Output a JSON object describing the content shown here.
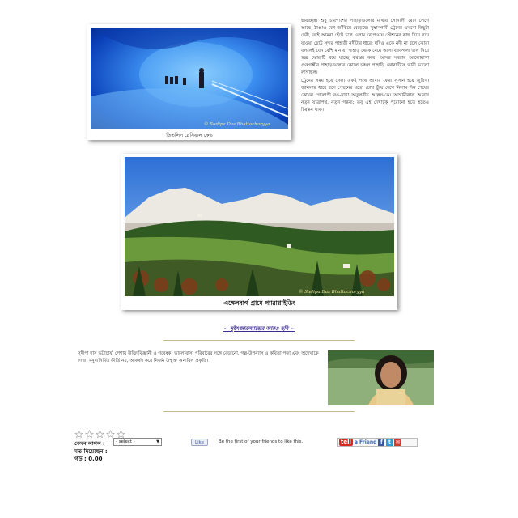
{
  "photo1": {
    "caption": "তিতলিস গ্লেসিয়াল কেভ",
    "watermark": "© Sudipa Das Bhattacharyya",
    "icon": "ice-cave-photo"
  },
  "article_text": {
    "p1": "ছায়াচ্ছন্ন। শুধু চারপাশের পাহাড়গুলোর মাথায় সোনালী রোদ লেগে আছে। ঠাণ্ডাও বেশ জাঁকিয়ে বেড়েছে। সুস্থানগামী ট্রেনের এখনো কিছুটা দেরী, তাই আমরা হেঁটে চলে এলাম রোপওয়ে স্টেশনের কাছ দিয়ে বয়ে যাওয়া ছোট্ট সুন্দর পাহাড়ী নদীটার ধারে; যদিও একে নদী না বলে ঝোরা বললেই যেন বেশি মানায়। পাহাড় থেকে নেমে আসা বরফগলা জল নিয়ে স্বচ্ছ ঝোরাটি বয়ে যাচ্ছে ঝরঝর করে। আসন্ন সন্ধ্যার আলোমাখা গুরুগম্ভীর পাহাড়গুলোর কোলে চঞ্চল পাহাড়ি ঝোরাটিকে ভারী ভালো লাগছিল।",
    "p2": "ট্রেনের সময় হয়ে গেল। একই পথে আবার ফেরা লুসার্ন হয়ে জুরিখ। জানলার ধারে বসে পেছনের মতো চোখ ছুঁয়ে দেখে নিলাম দিন শেষের কোমল গোলাপী রঙ-মাখা অতুলনীয় আল্পস-কে। আগামীকাল আবার নতুন যাত্রাপথ, নতুন গন্তব্য; তবু এই দেখাটুকু পুরোনো হতে হতেও চিরন্তন থাক।"
  },
  "photo2": {
    "caption": "এঙ্গেলবার্গ গ্রামে প্যারাগ্লাইডিং",
    "watermark": "© Sudipa Das Bhattacharyya",
    "icon": "alps-village-photo"
  },
  "more_link": "~ সুইৎজারল্যান্ডের আরও ছবি ~",
  "author": {
    "bio": "সুদীপা দাস ভট্টাচার্য্য পেশায় উদ্ভিদবিজ্ঞানী ও গবেষক। ভালোবাসা পরিবারের সঙ্গে বেড়ানো, গল্প-উপন্যাস ও কবিতা পড়া এবং অদেখাকে দেখা। মনুষ্যনির্মিত কীর্তি নয়, আকর্ষণ করে নির্জন উন্মুক্ত অনাবিল প্রকৃতি।",
    "photo_icon": "author-portrait"
  },
  "rating": {
    "star_count": 5,
    "label": "কেমন লাগল :",
    "select_value": "- select -",
    "votes_label": "মত দিয়েছেন :",
    "votes_value": "",
    "avg_label": "গড় :",
    "avg_value": "0.00"
  },
  "facebook": {
    "like_label": "Like",
    "text": "Be the first of your friends to like this."
  },
  "tell_a_friend": {
    "logo": "tell",
    "label": "a Friend"
  },
  "colors": {
    "link": "#3b2a8f",
    "rule": "#c9b98a",
    "fb_blue": "#3b5998",
    "tell_red": "#d62a1f"
  }
}
